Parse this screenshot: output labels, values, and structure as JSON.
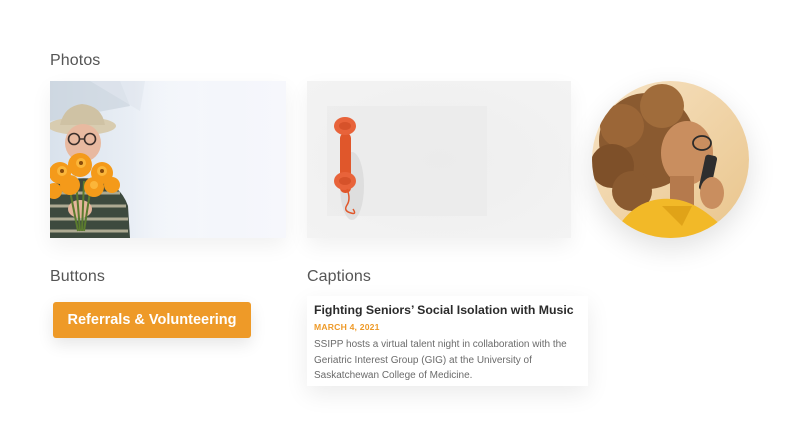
{
  "sections": {
    "photos_title": "Photos",
    "buttons_title": "Buttons",
    "captions_title": "Captions"
  },
  "photos": [
    {
      "name": "elderly-woman-with-flowers",
      "shape": "rectangle"
    },
    {
      "name": "orange-telephone-handset",
      "shape": "rectangle"
    },
    {
      "name": "woman-on-phone",
      "shape": "circle"
    }
  ],
  "button": {
    "label": "Referrals & Volunteering",
    "color": "#EE9A28"
  },
  "caption": {
    "title": "Fighting Seniors’ Social Isolation with Music",
    "date": "MARCH 4, 2021",
    "body": "SSIPP hosts a virtual talent night in collaboration with the Geriatric Interest Group (GIG) at the University of Saskatchewan College of Medicine."
  },
  "colors": {
    "accent": "#EE9A28",
    "heading_text": "#555555",
    "body_text": "#6b6b6b"
  }
}
